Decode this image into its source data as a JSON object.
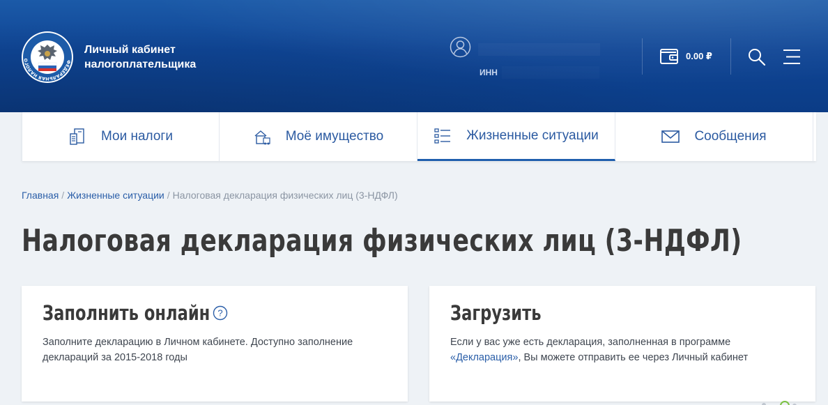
{
  "header": {
    "brand_line1": "Личный кабинет",
    "brand_line2": "налогоплательщика",
    "logo_ring_text": "ФЕДЕРАЛЬНАЯ НАЛОГОВАЯ СЛУЖБА",
    "inn_label": "ИНН",
    "balance": "0.00 ₽"
  },
  "nav": {
    "tabs": [
      {
        "label": "Мои налоги",
        "icon": "tax-docs-icon",
        "active": false
      },
      {
        "label": "Моё имущество",
        "icon": "property-icon",
        "active": false
      },
      {
        "label": "Жизненные ситуации",
        "icon": "list-icon",
        "active": true
      },
      {
        "label": "Сообщения",
        "icon": "envelope-icon",
        "active": false
      }
    ]
  },
  "breadcrumb": {
    "home": "Главная",
    "sep": "/",
    "section": "Жизненные ситуации",
    "current": "Налоговая декларация физических лиц (3-НДФЛ)"
  },
  "page": {
    "title": "Налоговая декларация физических лиц (3-НДФЛ)"
  },
  "cards": {
    "online": {
      "title": "Заполнить онлайн",
      "text": "Заполните декларацию в Личном кабинете. Доступно заполнение деклараций за 2015-2018 годы"
    },
    "upload": {
      "title": "Загрузить",
      "text_before": "Если у вас уже есть декларация, заполненная в программе ",
      "link": "«Декларация»",
      "text_after": ", Вы можете отправить ее через Личный кабинет"
    }
  },
  "colors": {
    "header_blue": "#0f4595",
    "link_blue": "#2a5ea8",
    "active_tab_underline": "#1f5fae",
    "title_text": "#3a3a3a",
    "page_bg": "#eef2f6"
  }
}
